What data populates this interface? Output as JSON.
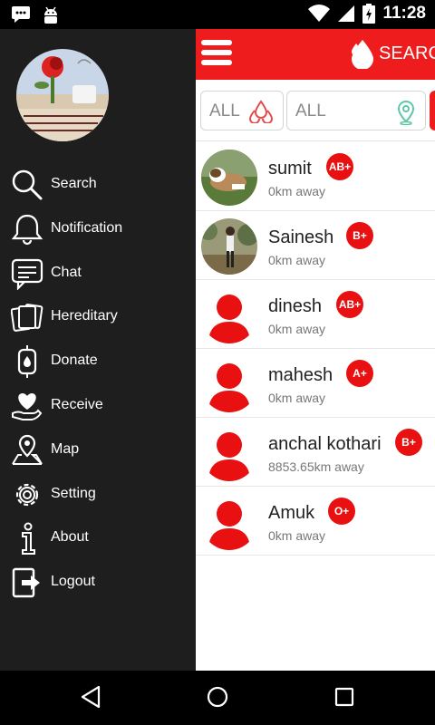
{
  "status_bar": {
    "time": "11:28"
  },
  "toolbar": {
    "search_label": "SEARC"
  },
  "filters": {
    "blood_group": "ALL",
    "location": "ALL"
  },
  "users": [
    {
      "name": "sumit",
      "distance": "0km away",
      "blood_group": "AB+",
      "avatar": "photo-dog"
    },
    {
      "name": "Sainesh",
      "distance": "0km away",
      "blood_group": "B+",
      "avatar": "photo-person"
    },
    {
      "name": "dinesh",
      "distance": "0km away",
      "blood_group": "AB+",
      "avatar": "default-user-icon"
    },
    {
      "name": "mahesh",
      "distance": "0km away",
      "blood_group": "A+",
      "avatar": "default-user-icon"
    },
    {
      "name": "anchal kothari",
      "distance": "8853.65km away",
      "blood_group": "B+",
      "avatar": "default-user-icon"
    },
    {
      "name": "Amuk",
      "distance": "0km away",
      "blood_group": "O+",
      "avatar": "default-user-icon"
    }
  ],
  "drawer": {
    "profile_image": "Good Morning flower and tea photo",
    "menu": [
      {
        "label": "Search",
        "icon": "search-icon"
      },
      {
        "label": "Notification",
        "icon": "bell-icon"
      },
      {
        "label": "Chat",
        "icon": "chat-icon"
      },
      {
        "label": "Hereditary",
        "icon": "cards-icon"
      },
      {
        "label": "Donate",
        "icon": "blood-bag-icon"
      },
      {
        "label": "Receive",
        "icon": "heart-hand-icon"
      },
      {
        "label": "Map",
        "icon": "map-pin-icon"
      },
      {
        "label": "Setting",
        "icon": "gear-icon"
      },
      {
        "label": "About",
        "icon": "info-icon"
      },
      {
        "label": "Logout",
        "icon": "logout-icon"
      }
    ]
  },
  "colors": {
    "accent": "#ee1c1c",
    "drawer_bg": "#1e1e1e"
  }
}
